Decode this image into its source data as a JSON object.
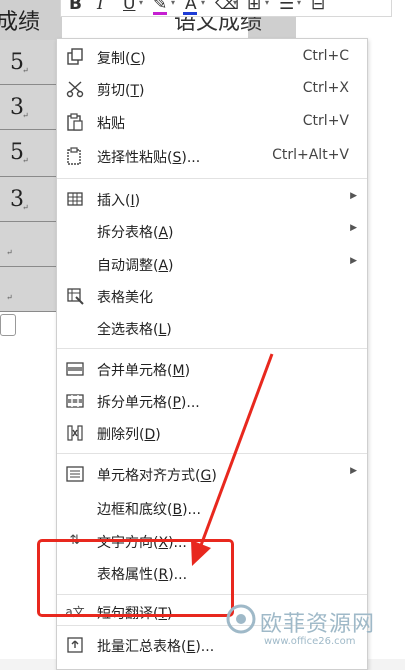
{
  "toolbar": {
    "bold": "B",
    "italic": "I",
    "underline": "U",
    "font_color": "A",
    "icons": [
      "highlight-icon",
      "clear-format-icon",
      "border-icon",
      "align-icon",
      "table-icon"
    ],
    "highlight_color": "#c51fd1",
    "font_color_bar": "#1d3bd6"
  },
  "background_table": {
    "header_left": "成绩",
    "header_right": "语文成绩",
    "cells": [
      "5",
      "3",
      "5",
      "3",
      "",
      ""
    ],
    "marker": "↵"
  },
  "menu": {
    "items": [
      {
        "icon": "copy-icon",
        "label": "复制(",
        "key": "C",
        "tail": ")",
        "shortcut": "Ctrl+C"
      },
      {
        "icon": "scissors-icon",
        "label": "剪切(",
        "key": "T",
        "tail": ")",
        "shortcut": "Ctrl+X"
      },
      {
        "icon": "paste-icon",
        "label": "粘贴",
        "key": "",
        "tail": "",
        "shortcut": "Ctrl+V"
      },
      {
        "icon": "paste-special-icon",
        "label": "选择性粘贴(",
        "key": "S",
        "tail": ")...",
        "shortcut": "Ctrl+Alt+V"
      },
      {
        "icon": "insert-table-icon",
        "label": "插入(",
        "key": "I",
        "tail": ")",
        "shortcut": "",
        "submenu": true
      },
      {
        "icon": "",
        "label": "拆分表格(",
        "key": "A",
        "tail": ")",
        "shortcut": "",
        "submenu": true
      },
      {
        "icon": "",
        "label": "自动调整(",
        "key": "A",
        "tail": ")",
        "shortcut": "",
        "submenu": true
      },
      {
        "icon": "table-beautify-icon",
        "label": "表格美化",
        "key": "",
        "tail": "",
        "shortcut": ""
      },
      {
        "icon": "",
        "label": "全选表格(",
        "key": "L",
        "tail": ")",
        "shortcut": ""
      },
      {
        "icon": "merge-cells-icon",
        "label": "合并单元格(",
        "key": "M",
        "tail": ")",
        "shortcut": ""
      },
      {
        "icon": "split-cells-icon",
        "label": "拆分单元格(",
        "key": "P",
        "tail": ")...",
        "shortcut": ""
      },
      {
        "icon": "delete-column-icon",
        "label": "删除列(",
        "key": "D",
        "tail": ")",
        "shortcut": ""
      },
      {
        "icon": "cell-align-icon",
        "label": "单元格对齐方式(",
        "key": "G",
        "tail": ")",
        "shortcut": "",
        "submenu": true
      },
      {
        "icon": "",
        "label": "边框和底纹(",
        "key": "B",
        "tail": ")...",
        "shortcut": ""
      },
      {
        "icon": "text-direction-icon",
        "label": "文字方向(",
        "key": "X",
        "tail": ")...",
        "shortcut": ""
      },
      {
        "icon": "",
        "label": "表格属性(",
        "key": "R",
        "tail": ")...",
        "shortcut": ""
      },
      {
        "icon": "translate-icon",
        "label": "短句翻译(",
        "key": "T",
        "tail": ")",
        "shortcut": ""
      },
      {
        "icon": "batch-summary-icon",
        "label": "批量汇总表格(",
        "key": "E",
        "tail": ")...",
        "shortcut": ""
      }
    ]
  },
  "annotation": {
    "color": "#e8281e"
  },
  "watermark": {
    "name": "欧菲资源网",
    "url": "www.office26.com",
    "color": "#9fb9c8"
  }
}
